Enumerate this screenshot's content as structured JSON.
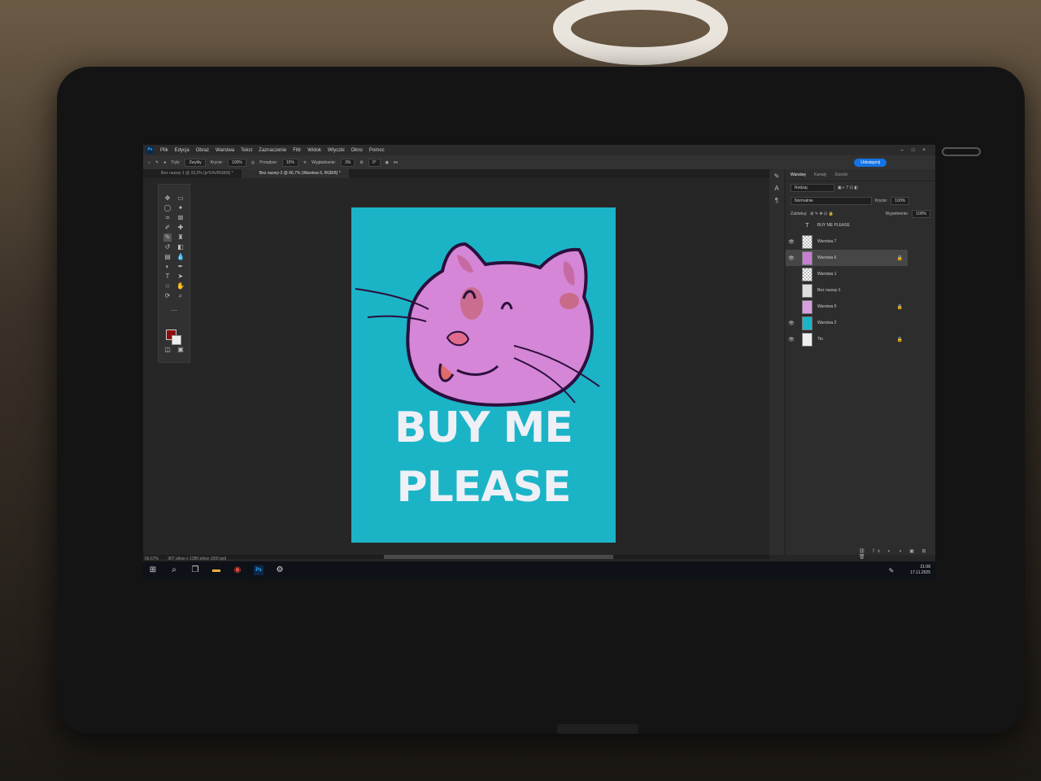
{
  "menubar": {
    "logo": "Ps",
    "items": [
      "Plik",
      "Edycja",
      "Obraz",
      "Warstwa",
      "Tekst",
      "Zaznaczenie",
      "Filtr",
      "Widok",
      "Wtyczki",
      "Okno",
      "Pomoc"
    ]
  },
  "options": {
    "mode_label": "Tryb:",
    "mode_value": "Zwykły",
    "opacity_label": "Krycie:",
    "opacity_value": "100%",
    "flow_label": "Przepływ:",
    "flow_value": "10%",
    "smoothing_label": "Wygładzanie:",
    "smoothing_value": "3%",
    "angle_value": "0°",
    "share_button": "Udostępnij"
  },
  "tabs": [
    {
      "label": "Bez nazwy-1 @ 33,3% (jeTo%/RGB/8) *"
    },
    {
      "label": "Bez nazwy-2 @ 66,7% (Warstwa 6, RGB/8) *"
    }
  ],
  "poster": {
    "line1": "BUY ME",
    "line2": "PLEASE",
    "bg_color": "#1bb4c7",
    "cat_color": "#d586d6"
  },
  "status": {
    "zoom": "66,67%",
    "doc_size": "907 pikse x 1280 pikse (300 ppi)"
  },
  "layers_panel": {
    "tabs": [
      "Warstwy",
      "Kanały",
      "Ścieżki"
    ],
    "search_placeholder": "Rodzaj",
    "blend_mode": "Normalnie",
    "opacity_label": "Krycie:",
    "opacity_value": "100%",
    "lock_label": "Zablokuj:",
    "fill_label": "Wypełnienie:",
    "fill_value": "100%",
    "layers": [
      {
        "name": "BUY ME PLEASE",
        "kind": "text"
      },
      {
        "name": "Warstwa 7",
        "kind": "pixel"
      },
      {
        "name": "Warstwa 6",
        "kind": "pixel"
      },
      {
        "name": "Warstwa 1",
        "kind": "pixel"
      },
      {
        "name": "Bez nazwy-1",
        "kind": "pixel"
      },
      {
        "name": "Warstwa 5",
        "kind": "pixel"
      },
      {
        "name": "Warstwa 2",
        "kind": "fill"
      },
      {
        "name": "Tło",
        "kind": "background"
      }
    ]
  },
  "taskbar": {
    "time": "21:08",
    "date": "17.11.2025"
  }
}
